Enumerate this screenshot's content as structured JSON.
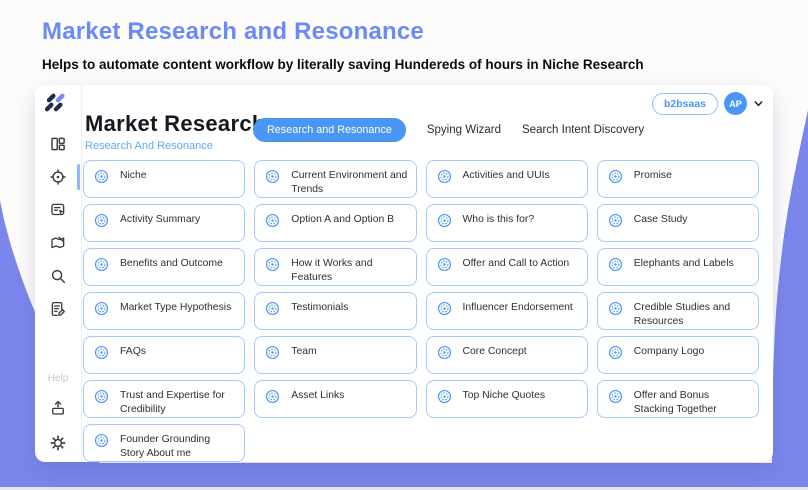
{
  "colors": {
    "brand-purple": "#7B86EC",
    "accent-blue": "#4A96F5",
    "title-blue": "#6A8AFA",
    "card-border": "#A6CBF8",
    "link-blue": "#5EA9F6",
    "dark-text": "#17171F",
    "sidebar-icon": "#3A3A42",
    "help-gray": "#C9C9C9"
  },
  "page": {
    "title": "Market Research and Resonance",
    "subtitle": "Helps to automate content workflow by literally saving Hundereds of hours in Niche Research"
  },
  "app": {
    "header": {
      "title": "Market Research",
      "subtitle": "Research And Resonance",
      "tabs": [
        {
          "label": "Research and Resonance",
          "active": true
        },
        {
          "label": "Spying Wizard",
          "active": false
        },
        {
          "label": "Search Intent Discovery",
          "active": false
        }
      ],
      "workspace_badge": "b2bsaas",
      "avatar_initials": "AP",
      "account_chevron_icon": "chevron-down-icon"
    },
    "sidebar": {
      "logo_icon": "double-slash-logo",
      "nav_items": [
        {
          "id": "dashboard",
          "icon": "dashboard-icon",
          "active": false
        },
        {
          "id": "research-target",
          "icon": "target-icon",
          "active": true
        },
        {
          "id": "document-review",
          "icon": "document-cursor-icon",
          "active": false
        },
        {
          "id": "planning-map",
          "icon": "map-edit-icon",
          "active": false
        },
        {
          "id": "search",
          "icon": "search-icon",
          "active": false
        },
        {
          "id": "notes",
          "icon": "note-edit-icon",
          "active": false
        }
      ],
      "help_label": "Help",
      "footer_items": [
        {
          "id": "export",
          "icon": "box-upload-icon",
          "active": false
        },
        {
          "id": "settings",
          "icon": "gear-icon",
          "active": false
        }
      ]
    },
    "card_icon": "target-rings-icon",
    "cards": [
      "Niche",
      "Current Environment and Trends",
      "Activities and UUIs",
      "Promise",
      "Activity Summary",
      "Option A and Option B",
      "Who is this for?",
      "Case Study",
      "Benefits and Outcome",
      "How it Works and Features",
      "Offer and Call to Action",
      "Elephants and Labels",
      "Market Type Hypothesis",
      "Testimonials",
      "Influencer Endorsement",
      "Credible Studies and Resources",
      "FAQs",
      "Team",
      "Core Concept",
      "Company Logo",
      "Trust and Expertise for Credibility",
      "Asset Links",
      "Top Niche Quotes",
      "Offer and Bonus Stacking Together",
      "Founder Grounding Story About me"
    ]
  }
}
